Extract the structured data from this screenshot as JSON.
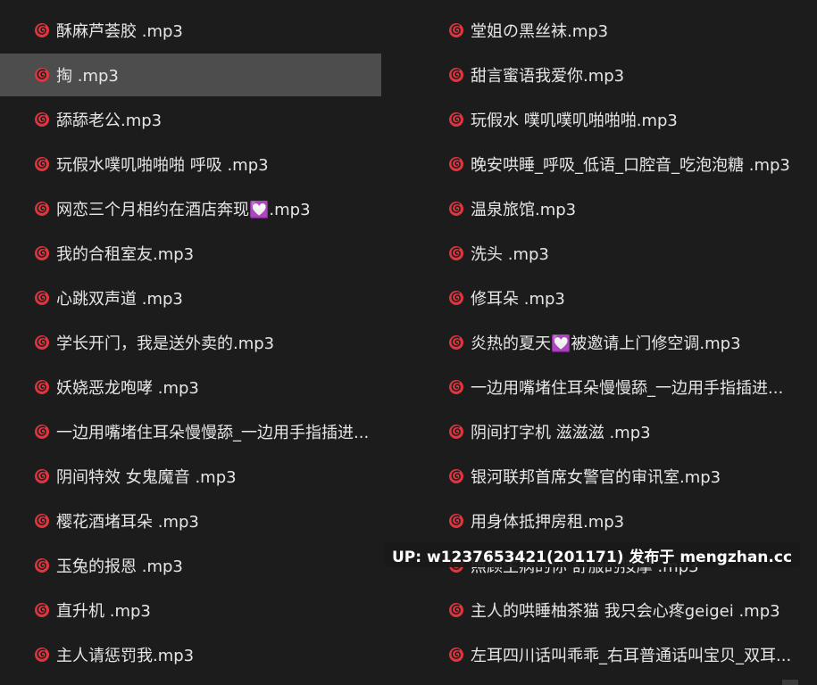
{
  "icon_color": "#e0343f",
  "left_files": [
    {
      "name": "酥麻芦荟胶 .mp3",
      "selected": false
    },
    {
      "name": "掏 .mp3",
      "selected": true
    },
    {
      "name": "舔舔老公.mp3",
      "selected": false
    },
    {
      "name": "玩假水噗叽啪啪啪 呼吸 .mp3",
      "selected": false
    },
    {
      "name": "网恋三个月相约在酒店奔现💟.mp3",
      "selected": false
    },
    {
      "name": "我的合租室友.mp3",
      "selected": false
    },
    {
      "name": "心跳双声道 .mp3",
      "selected": false
    },
    {
      "name": "学长开门，我是送外卖的.mp3",
      "selected": false
    },
    {
      "name": "妖娆恶龙咆哮 .mp3",
      "selected": false
    },
    {
      "name": "一边用嘴堵住耳朵慢慢舔_一边用手指插进...",
      "selected": false
    },
    {
      "name": "阴间特效 女鬼魔音 .mp3",
      "selected": false
    },
    {
      "name": "樱花酒堵耳朵 .mp3",
      "selected": false
    },
    {
      "name": "玉兔的报恩 .mp3",
      "selected": false
    },
    {
      "name": "直升机 .mp3",
      "selected": false
    },
    {
      "name": "主人请惩罚我.mp3",
      "selected": false
    }
  ],
  "right_files": [
    {
      "name": "堂姐の黑丝袜.mp3",
      "selected": false
    },
    {
      "name": "甜言蜜语我爱你.mp3",
      "selected": false
    },
    {
      "name": "玩假水 噗叽噗叽啪啪啪.mp3",
      "selected": false
    },
    {
      "name": "晚安哄睡_呼吸_低语_口腔音_吃泡泡糖 .mp3",
      "selected": false
    },
    {
      "name": "温泉旅馆.mp3",
      "selected": false
    },
    {
      "name": "洗头 .mp3",
      "selected": false
    },
    {
      "name": "修耳朵 .mp3",
      "selected": false
    },
    {
      "name": "炎热的夏天💟被邀请上门修空调.mp3",
      "selected": false
    },
    {
      "name": "一边用嘴堵住耳朵慢慢舔_一边用手指插进...",
      "selected": false
    },
    {
      "name": "阴间打字机 滋滋滋 .mp3",
      "selected": false
    },
    {
      "name": "银河联邦首席女警官的审讯室.mp3",
      "selected": false
    },
    {
      "name": "用身体抵押房租.mp3",
      "selected": false
    },
    {
      "name": "照顾生病的你 舒服的按摩 .mp3",
      "selected": false
    },
    {
      "name": "主人的哄睡柚茶猫 我只会心疼geigei .mp3",
      "selected": false
    },
    {
      "name": "左耳四川话叫乖乖_右耳普通话叫宝贝_双耳...",
      "selected": false
    }
  ],
  "watermark": "UP: w1237653421(201171) 发布于 mengzhan.cc"
}
